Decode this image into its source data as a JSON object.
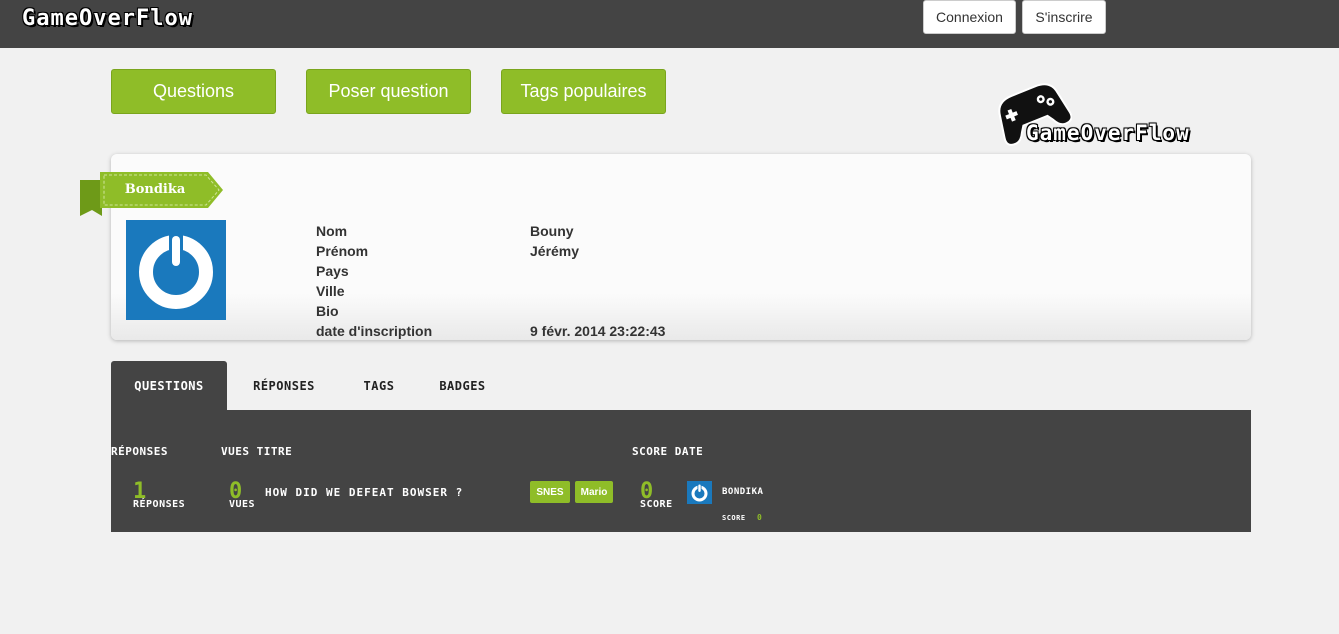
{
  "header": {
    "brand": "GameOverFlow",
    "login_label": "Connexion",
    "signup_label": "S'inscrire"
  },
  "nav": {
    "questions": "Questions",
    "ask": "Poser question",
    "tags": "Tags populaires"
  },
  "logo": {
    "text": "GameOverFlow"
  },
  "profile": {
    "username": "Bondika",
    "fields": [
      {
        "label": "Nom",
        "value": "Bouny"
      },
      {
        "label": "Prénom",
        "value": "Jérémy"
      },
      {
        "label": "Pays",
        "value": ""
      },
      {
        "label": "Ville",
        "value": ""
      },
      {
        "label": "Bio",
        "value": ""
      },
      {
        "label": "date d'inscription",
        "value": "9 févr. 2014 23:22:43"
      }
    ]
  },
  "tabs": [
    {
      "label": "Questions",
      "active": true
    },
    {
      "label": "Réponses",
      "active": false
    },
    {
      "label": "Tags",
      "active": false
    },
    {
      "label": "Badges",
      "active": false
    }
  ],
  "table": {
    "headers": {
      "answers": "Réponses",
      "views_title": "Vues Titre",
      "score_date": "Score Date"
    },
    "rows": [
      {
        "answers_count": "1",
        "answers_label": "Réponses",
        "views_count": "0",
        "views_label": "Vues",
        "title": "How did we defeat Bowser ?",
        "tags": [
          "SNES",
          "Mario"
        ],
        "score": "0",
        "score_label": "Score",
        "author": "Bondika",
        "author_score_label": "score",
        "author_score": "0"
      }
    ]
  },
  "colors": {
    "topbar": "#444444",
    "accent_green": "#8fbd28",
    "avatar_blue": "#1a79bd"
  },
  "icons": {
    "logo": "gamepad-icon",
    "avatar": "power-icon"
  }
}
